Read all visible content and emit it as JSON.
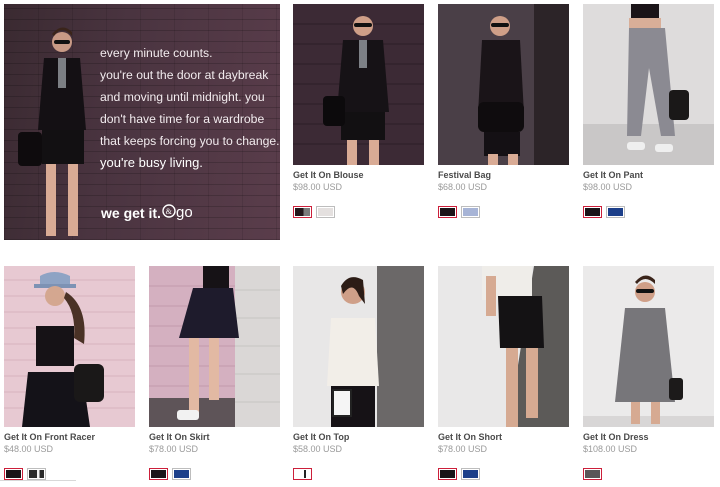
{
  "promo": {
    "lines": [
      "every minute counts.",
      "you're out the door at daybreak",
      "and moving until midnight. you",
      "don't have time for a wardrobe",
      "that keeps forcing you to change.",
      "you're busy living."
    ],
    "signoff": "we get it.",
    "logo_text": "&go"
  },
  "products": [
    {
      "name": "Get It On Blouse",
      "price": "$98.00 USD",
      "swatches": [
        "#24181c",
        "#e4e0df"
      ],
      "photo": "blouse"
    },
    {
      "name": "Festival Bag",
      "price": "$68.00 USD",
      "swatches": [
        "#1c1418",
        "#a7b4d6"
      ],
      "photo": "bag"
    },
    {
      "name": "Get It On Pant",
      "price": "$98.00 USD",
      "swatches": [
        "#1a1418",
        "#1c3f8a"
      ],
      "photo": "pant"
    },
    {
      "name": "Get It On Front Racer",
      "price": "$48.00 USD",
      "swatches": [
        "#1a1418",
        "#2a2a2a"
      ],
      "photo": "racer"
    },
    {
      "name": "Get It On Skirt",
      "price": "$78.00 USD",
      "swatches": [
        "#1a1418",
        "#1c3f8a"
      ],
      "photo": "skirt"
    },
    {
      "name": "Get It On Top",
      "price": "$58.00 USD",
      "swatches": [
        "#ffffff"
      ],
      "photo": "top"
    },
    {
      "name": "Get It On Short",
      "price": "$78.00 USD",
      "swatches": [
        "#1a1418",
        "#1c3f8a"
      ],
      "photo": "short"
    },
    {
      "name": "Get It On Dress",
      "price": "$108.00 USD",
      "swatches": [
        "#5a5658"
      ],
      "photo": "dress"
    }
  ],
  "colors": {
    "selected_border": "#cc1f3a",
    "name_text": "#4a4a4a",
    "price_text": "#9a9a9a"
  }
}
